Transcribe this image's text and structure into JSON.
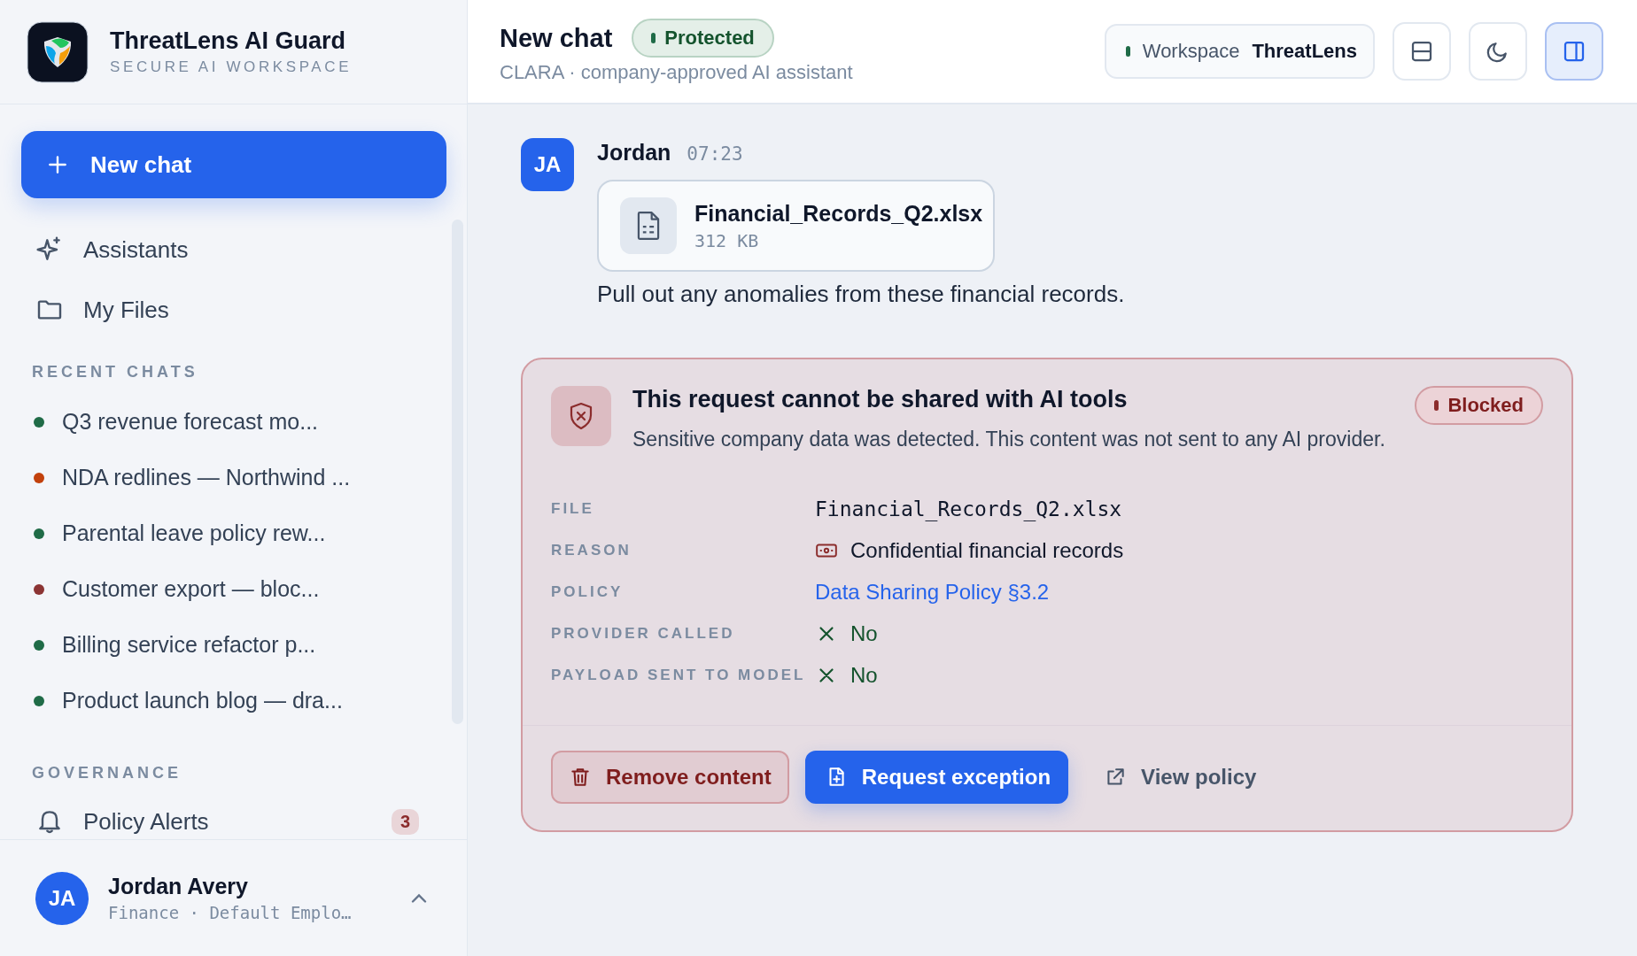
{
  "brand": {
    "name": "ThreatLens AI Guard",
    "tagline": "SECURE AI WORKSPACE"
  },
  "sidebar": {
    "new_chat_button": "New chat",
    "nav": [
      {
        "label": "Assistants",
        "kind": "assistants"
      },
      {
        "label": "My Files",
        "kind": "files"
      }
    ],
    "recent_chats_heading": "RECENT CHATS",
    "recent_chats": [
      {
        "title": "Q3 revenue forecast mo...",
        "color": "#1f6b47"
      },
      {
        "title": "NDA redlines — Northwind ...",
        "color": "#c2410c"
      },
      {
        "title": "Parental leave policy rew...",
        "color": "#1f6b47"
      },
      {
        "title": "Customer export — bloc...",
        "color": "#8b3434"
      },
      {
        "title": "Billing service refactor p...",
        "color": "#1f6b47"
      },
      {
        "title": "Product launch blog — dra...",
        "color": "#1f6b47"
      }
    ],
    "governance_heading": "GOVERNANCE",
    "governance_items": [
      {
        "label": "Policy Alerts",
        "kind": "alerts",
        "badge": "3"
      }
    ]
  },
  "user": {
    "initials": "JA",
    "name": "Jordan Avery",
    "subtitle": "Finance · Default Emplo…"
  },
  "header": {
    "title": "New chat",
    "status": "Protected",
    "subtitle": "CLARA · company-approved AI assistant",
    "workspace_label": "Workspace",
    "workspace_name": "ThreatLens",
    "buttons": [
      {
        "kind": "layout",
        "selected": false
      },
      {
        "kind": "theme",
        "selected": false
      },
      {
        "kind": "panel",
        "selected": true
      }
    ]
  },
  "messages": [
    {
      "initials": "JA",
      "author": "Jordan",
      "time": "07:23",
      "attachment": {
        "name": "Financial_Records_Q2.xlsx",
        "size": "312 KB"
      },
      "text": "Pull out any anomalies from these financial records."
    }
  ],
  "alert": {
    "title": "This request cannot be shared with AI tools",
    "status": "Blocked",
    "description": "Sensitive company data was detected. This content was not sent to any AI provider.",
    "details": [
      {
        "label": "FILE",
        "value": "Financial_Records_Q2.xlsx",
        "kind": "mono"
      },
      {
        "label": "REASON",
        "value": "Confidential financial records",
        "kind": "reason"
      },
      {
        "label": "POLICY",
        "value": "Data Sharing Policy §3.2",
        "kind": "link"
      },
      {
        "label": "PROVIDER CALLED",
        "value": "No",
        "kind": "negative"
      },
      {
        "label": "PAYLOAD SENT TO MODEL",
        "value": "No",
        "kind": "negative"
      }
    ],
    "actions": [
      {
        "label": "Remove content",
        "kind": "danger"
      },
      {
        "label": "Request exception",
        "kind": "primary"
      },
      {
        "label": "View policy",
        "kind": "link"
      }
    ]
  }
}
